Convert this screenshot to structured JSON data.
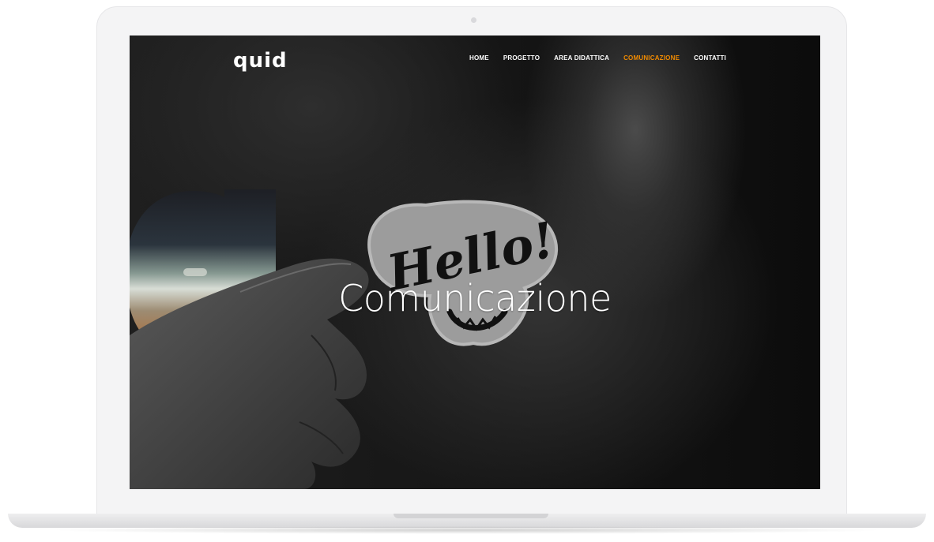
{
  "site": {
    "logo": "quid",
    "nav": [
      {
        "label": "Home",
        "active": false
      },
      {
        "label": "Progetto",
        "active": false
      },
      {
        "label": "Area Didattica",
        "active": false
      },
      {
        "label": "Comunicazione",
        "active": true
      },
      {
        "label": "Contatti",
        "active": false
      }
    ],
    "hero_title": "Comunicazione",
    "sticker_text": "Hello!"
  },
  "colors": {
    "accent": "#f08a00",
    "text": "#ffffff",
    "screen_bg": "#141414",
    "bezel": "#f4f4f5"
  }
}
